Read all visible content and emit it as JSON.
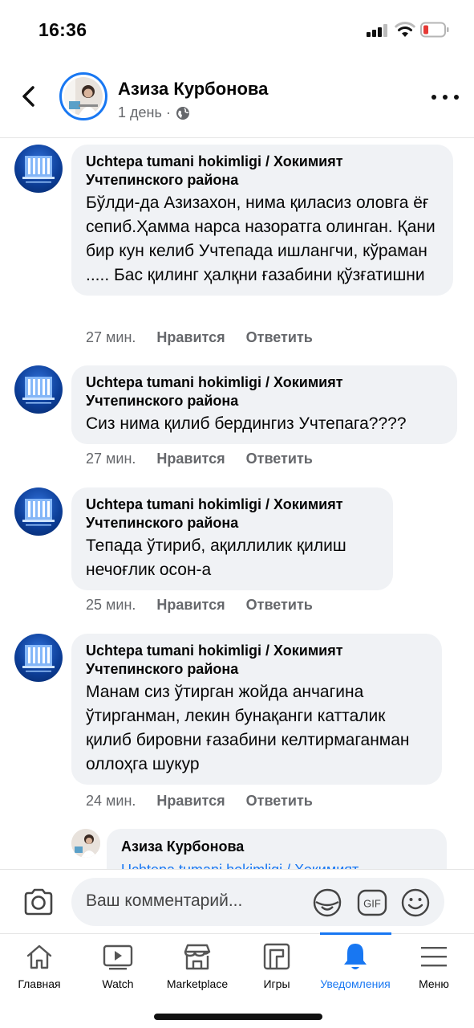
{
  "status_bar": {
    "time": "16:36"
  },
  "header": {
    "name": "Азиза Курбонова",
    "meta": "1 день ·"
  },
  "comments": [
    {
      "author_line1": "Uchtepa tumani hokimligi / Хокимият",
      "author_line2": "Учтепинского района",
      "text": "Бўлди-да Азизахон, нима қиласиз оловга ёғ сепиб.Ҳамма нарса назоратга олинган. Қани бир кун келиб Учтепада ишлангчи, кўраман ..... Бас қилинг ҳалқни ғазабини қўзғатишни",
      "time": "27 мин.",
      "like": "Нравится",
      "reply": "Ответить"
    },
    {
      "author_line1": "Uchtepa tumani hokimligi / Хокимият",
      "author_line2": "Учтепинского района",
      "text": "Сиз нима қилиб бердингиз Учтепага????",
      "time": "27 мин.",
      "like": "Нравится",
      "reply": "Ответить"
    },
    {
      "author_line1": "Uchtepa tumani hokimligi / Хокимият",
      "author_line2": "Учтепинского района",
      "text": "Тепада ўтириб, ақиллилик қилиш нечоғлик осон-а",
      "time": "25 мин.",
      "like": "Нравится",
      "reply": "Ответить"
    },
    {
      "author_line1": "Uchtepa tumani hokimligi / Хокимият",
      "author_line2": "Учтепинского района",
      "text": "Манам сиз ўтирган жойда анчагина ўтирганман, лекин бунақанги катталик қилиб бировни ғазабини келтирмаганман оллоҳга шукур",
      "time": "24 мин.",
      "like": "Нравится",
      "reply": "Ответить"
    }
  ],
  "reply_preview": {
    "author": "Азиза Курбонова",
    "mention": "Uchtepa tumani hokimligi / Хокимият"
  },
  "composer": {
    "placeholder": "Ваш комментарий..."
  },
  "tabs": [
    {
      "label": "Главная",
      "icon": "home-icon"
    },
    {
      "label": "Watch",
      "icon": "watch-icon"
    },
    {
      "label": "Marketplace",
      "icon": "marketplace-icon"
    },
    {
      "label": "Игры",
      "icon": "games-icon"
    },
    {
      "label": "Уведомления",
      "icon": "bell-icon",
      "active": true
    },
    {
      "label": "Меню",
      "icon": "menu-icon"
    }
  ],
  "colors": {
    "accent": "#1877f2",
    "bubble": "#f0f2f5",
    "secondary_text": "#65676b"
  }
}
